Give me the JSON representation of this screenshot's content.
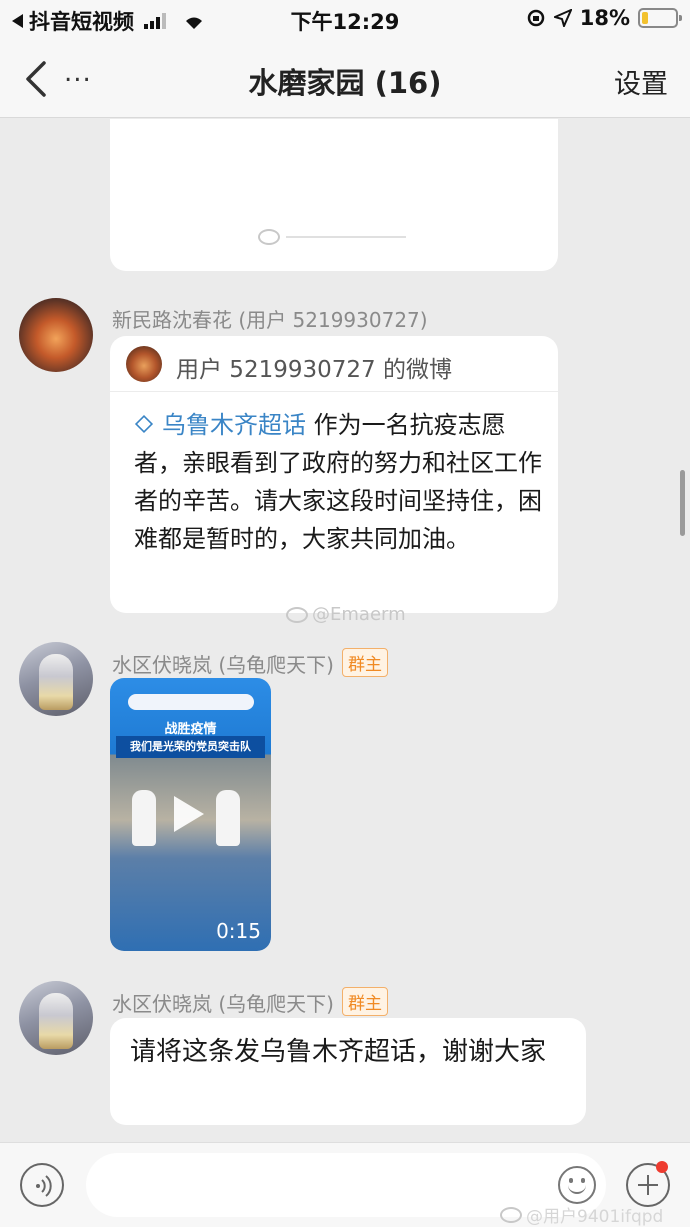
{
  "status_bar": {
    "back_app": "抖音短视频",
    "time": "下午12:29",
    "battery": "18%",
    "battery_level": 0.18
  },
  "nav": {
    "more": "...",
    "title": "水磨家园 (16)",
    "settings": "设置"
  },
  "messages": [
    {
      "sender": "新民路沈春花 (用户 5219930727)",
      "card_title": "用户 5219930727 的微博",
      "topic": "乌鲁木齐超话",
      "body": " 作为一名抗疫志愿者，亲眼看到了政府的努力和社区工作者的辛苦。请大家这段时间坚持住，困难都是暂时的，大家共同加油。"
    },
    {
      "sender": "水区伏晓岚 (乌龟爬天下)",
      "badge": "群主",
      "video_line1": "战胜疫情",
      "video_line2": "我们是光荣的党员突击队",
      "duration": "0:15"
    },
    {
      "sender": "水区伏晓岚 (乌龟爬天下)",
      "badge": "群主",
      "text": "请将这条发乌鲁木齐超话，谢谢大家"
    }
  ],
  "watermarks": {
    "center": "@Emaerm",
    "bottom": "@用户9401ifqpd"
  },
  "input": {
    "placeholder": ""
  },
  "colors": {
    "topic_blue": "#3a85c6",
    "badge_orange": "#f08a24",
    "notify_red": "#ee3b2f"
  }
}
